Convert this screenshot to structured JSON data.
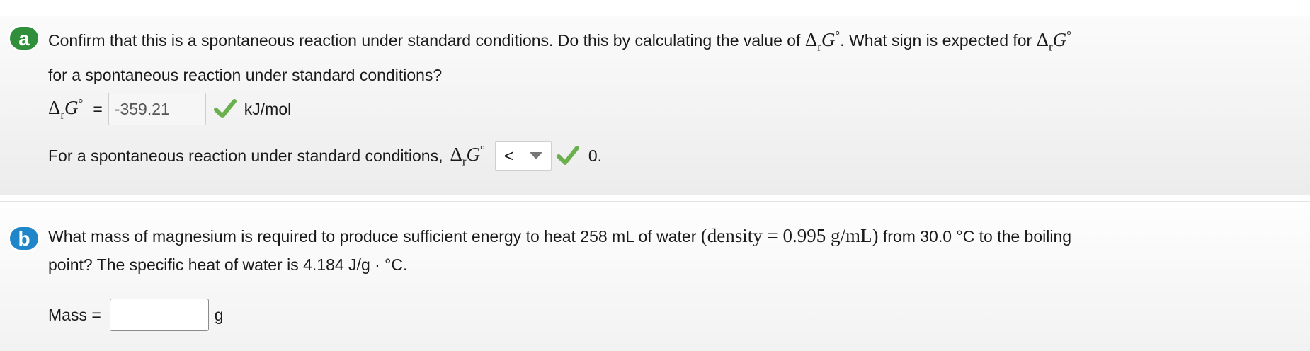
{
  "part_a": {
    "badge": "a",
    "question_text_1": "Confirm that this is a spontaneous reaction under standard conditions. Do this by calculating the value of ",
    "question_text_2": ". What sign is expected for ",
    "question_text_3": "for a spontaneous reaction under standard conditions?",
    "delta_g_answer_label_eq": "=",
    "delta_g_value": "-359.21",
    "delta_g_unit": "kJ/mol",
    "sign_prefix": "For a spontaneous reaction under standard conditions,",
    "sign_selected": "<",
    "sign_suffix": "0.",
    "check_color": "#6ab04c"
  },
  "part_b": {
    "badge": "b",
    "question_text_1": "What mass of magnesium is required to produce sufficient energy to heat 258 mL of water",
    "density_math": "(density = 0.995 g/mL)",
    "question_text_2": "from 30.0 °C to the boiling",
    "question_text_3": "point? The specific heat of water is 4.184 J/g · °C.",
    "mass_label": "Mass =",
    "mass_value": "",
    "mass_unit": "g"
  },
  "math": {
    "delta": "Δ",
    "subscript": "r",
    "symbol": "G",
    "degree": "°"
  }
}
